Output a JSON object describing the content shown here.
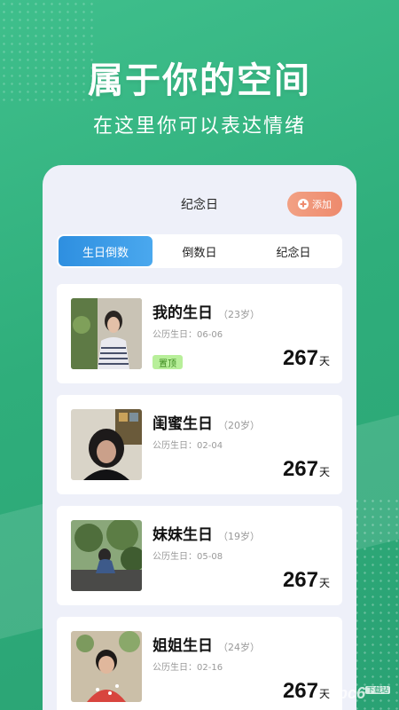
{
  "hero": {
    "title": "属于你的空间",
    "subtitle": "在这里你可以表达情绪"
  },
  "app": {
    "title": "纪念日",
    "add_label": "添加",
    "tabs": [
      {
        "label": "生日倒数",
        "active": true
      },
      {
        "label": "倒数日",
        "active": false
      },
      {
        "label": "纪念日",
        "active": false
      }
    ],
    "cards": [
      {
        "name": "我的生日",
        "age": "（23岁）",
        "date": "公历生日：06-06",
        "badge": "置顶",
        "days": "267",
        "unit": "天"
      },
      {
        "name": "闺蜜生日",
        "age": "（20岁）",
        "date": "公历生日：02-04",
        "days": "267",
        "unit": "天"
      },
      {
        "name": "妹妹生日",
        "age": "（19岁）",
        "date": "公历生日：05-08",
        "days": "267",
        "unit": "天"
      },
      {
        "name": "姐姐生日",
        "age": "（24岁）",
        "date": "公历生日：02-16",
        "days": "267",
        "unit": "天"
      }
    ]
  },
  "watermark": {
    "text": "pc6",
    "tag": "下载站"
  },
  "colors": {
    "background": "#2fae7b",
    "accent_tab": "#2e8fe0",
    "add_button": "#ee8a6d",
    "badge": "#b8ef9a"
  }
}
